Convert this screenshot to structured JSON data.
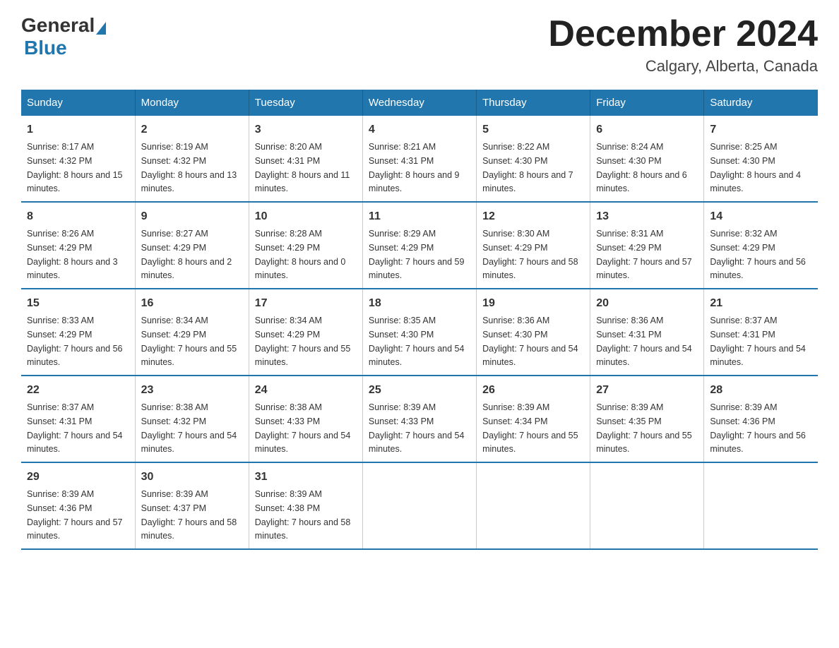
{
  "logo": {
    "general": "General",
    "blue": "Blue"
  },
  "header": {
    "month": "December 2024",
    "location": "Calgary, Alberta, Canada"
  },
  "days_of_week": [
    "Sunday",
    "Monday",
    "Tuesday",
    "Wednesday",
    "Thursday",
    "Friday",
    "Saturday"
  ],
  "weeks": [
    [
      {
        "day": "1",
        "sunrise": "8:17 AM",
        "sunset": "4:32 PM",
        "daylight": "8 hours and 15 minutes."
      },
      {
        "day": "2",
        "sunrise": "8:19 AM",
        "sunset": "4:32 PM",
        "daylight": "8 hours and 13 minutes."
      },
      {
        "day": "3",
        "sunrise": "8:20 AM",
        "sunset": "4:31 PM",
        "daylight": "8 hours and 11 minutes."
      },
      {
        "day": "4",
        "sunrise": "8:21 AM",
        "sunset": "4:31 PM",
        "daylight": "8 hours and 9 minutes."
      },
      {
        "day": "5",
        "sunrise": "8:22 AM",
        "sunset": "4:30 PM",
        "daylight": "8 hours and 7 minutes."
      },
      {
        "day": "6",
        "sunrise": "8:24 AM",
        "sunset": "4:30 PM",
        "daylight": "8 hours and 6 minutes."
      },
      {
        "day": "7",
        "sunrise": "8:25 AM",
        "sunset": "4:30 PM",
        "daylight": "8 hours and 4 minutes."
      }
    ],
    [
      {
        "day": "8",
        "sunrise": "8:26 AM",
        "sunset": "4:29 PM",
        "daylight": "8 hours and 3 minutes."
      },
      {
        "day": "9",
        "sunrise": "8:27 AM",
        "sunset": "4:29 PM",
        "daylight": "8 hours and 2 minutes."
      },
      {
        "day": "10",
        "sunrise": "8:28 AM",
        "sunset": "4:29 PM",
        "daylight": "8 hours and 0 minutes."
      },
      {
        "day": "11",
        "sunrise": "8:29 AM",
        "sunset": "4:29 PM",
        "daylight": "7 hours and 59 minutes."
      },
      {
        "day": "12",
        "sunrise": "8:30 AM",
        "sunset": "4:29 PM",
        "daylight": "7 hours and 58 minutes."
      },
      {
        "day": "13",
        "sunrise": "8:31 AM",
        "sunset": "4:29 PM",
        "daylight": "7 hours and 57 minutes."
      },
      {
        "day": "14",
        "sunrise": "8:32 AM",
        "sunset": "4:29 PM",
        "daylight": "7 hours and 56 minutes."
      }
    ],
    [
      {
        "day": "15",
        "sunrise": "8:33 AM",
        "sunset": "4:29 PM",
        "daylight": "7 hours and 56 minutes."
      },
      {
        "day": "16",
        "sunrise": "8:34 AM",
        "sunset": "4:29 PM",
        "daylight": "7 hours and 55 minutes."
      },
      {
        "day": "17",
        "sunrise": "8:34 AM",
        "sunset": "4:29 PM",
        "daylight": "7 hours and 55 minutes."
      },
      {
        "day": "18",
        "sunrise": "8:35 AM",
        "sunset": "4:30 PM",
        "daylight": "7 hours and 54 minutes."
      },
      {
        "day": "19",
        "sunrise": "8:36 AM",
        "sunset": "4:30 PM",
        "daylight": "7 hours and 54 minutes."
      },
      {
        "day": "20",
        "sunrise": "8:36 AM",
        "sunset": "4:31 PM",
        "daylight": "7 hours and 54 minutes."
      },
      {
        "day": "21",
        "sunrise": "8:37 AM",
        "sunset": "4:31 PM",
        "daylight": "7 hours and 54 minutes."
      }
    ],
    [
      {
        "day": "22",
        "sunrise": "8:37 AM",
        "sunset": "4:31 PM",
        "daylight": "7 hours and 54 minutes."
      },
      {
        "day": "23",
        "sunrise": "8:38 AM",
        "sunset": "4:32 PM",
        "daylight": "7 hours and 54 minutes."
      },
      {
        "day": "24",
        "sunrise": "8:38 AM",
        "sunset": "4:33 PM",
        "daylight": "7 hours and 54 minutes."
      },
      {
        "day": "25",
        "sunrise": "8:39 AM",
        "sunset": "4:33 PM",
        "daylight": "7 hours and 54 minutes."
      },
      {
        "day": "26",
        "sunrise": "8:39 AM",
        "sunset": "4:34 PM",
        "daylight": "7 hours and 55 minutes."
      },
      {
        "day": "27",
        "sunrise": "8:39 AM",
        "sunset": "4:35 PM",
        "daylight": "7 hours and 55 minutes."
      },
      {
        "day": "28",
        "sunrise": "8:39 AM",
        "sunset": "4:36 PM",
        "daylight": "7 hours and 56 minutes."
      }
    ],
    [
      {
        "day": "29",
        "sunrise": "8:39 AM",
        "sunset": "4:36 PM",
        "daylight": "7 hours and 57 minutes."
      },
      {
        "day": "30",
        "sunrise": "8:39 AM",
        "sunset": "4:37 PM",
        "daylight": "7 hours and 58 minutes."
      },
      {
        "day": "31",
        "sunrise": "8:39 AM",
        "sunset": "4:38 PM",
        "daylight": "7 hours and 58 minutes."
      },
      null,
      null,
      null,
      null
    ]
  ]
}
